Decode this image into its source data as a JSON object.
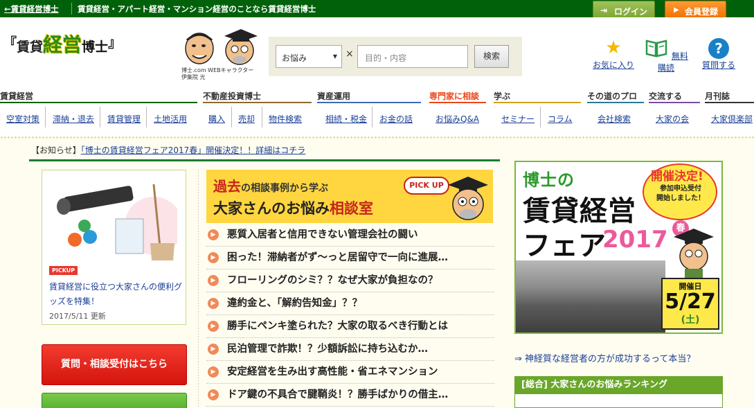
{
  "topbar": {
    "back_link": "←賃貸経営博士",
    "tagline": "賃貸経営・アパート経営・マンション経営のことなら賃貸経営博士",
    "login_label": "ログイン",
    "register_label": "会員登録"
  },
  "header": {
    "logo": {
      "open": "『",
      "part1": "賃貸",
      "part2": "経営",
      "part3": "博士",
      "close": "』"
    },
    "char_caption_1": "博士.com WEBキャラクター",
    "char_caption_2": "伊集院 光",
    "search": {
      "select_value": "お悩み",
      "times": "×",
      "keyword_placeholder": "目的・内容",
      "button_label": "検索"
    },
    "icons": [
      {
        "icon": "star-icon",
        "label": "お気に入り"
      },
      {
        "icon": "book-icon",
        "label": "無料購読"
      },
      {
        "icon": "question-icon",
        "label": "質問する"
      }
    ]
  },
  "nav": {
    "categories": [
      {
        "label": "賃貸経営",
        "color": "#00610a"
      },
      {
        "label": "不動産投資博士",
        "color": "#8b6a2e"
      },
      {
        "label": "資産運用",
        "color": "#3a6ab8"
      },
      {
        "label": "専門家に相談",
        "color": "#e9451c"
      },
      {
        "label": "学ぶ",
        "color": "#d4a018"
      },
      {
        "label": "その道のプロ",
        "color": "#2a7a8a"
      },
      {
        "label": "交流する",
        "color": "#7a4aa8"
      },
      {
        "label": "月刊誌",
        "color": "#333333"
      }
    ],
    "items": [
      "空室対策",
      "滞納・退去",
      "賃貸管理",
      "土地活用",
      "購入",
      "売却",
      "物件検索",
      "相続・税金",
      "お金の話",
      "お悩みQ&A",
      "セミナー",
      "コラム",
      "会社検索",
      "大家の会",
      "大家倶楽部"
    ]
  },
  "notice": {
    "prefix": "【お知らせ】",
    "link": "「博士の賃貸経営フェア2017春」開催決定！！詳細はコチラ"
  },
  "pickup_card": {
    "badge": "PICKUP",
    "title": "賃貸経営に役立つ大家さんの便利グッズを特集！",
    "date": "2017/5/11 更新"
  },
  "left_buttons": {
    "consult": "質問・相談受付はこちら"
  },
  "banner": {
    "line1_red": "過去",
    "line1_rest": "の相談事例から学ぶ",
    "line2_black": "大家さんのお悩み",
    "line2_red": "相談室",
    "pickup": "PICK UP"
  },
  "consult_list": [
    "悪質入居者と信用できない管理会社の闘い",
    "困った！滞納者がず～っと居留守で一向に進展…",
    "フローリングのシミ？？なぜ大家が負担なの？",
    "違約金と、「解約告知金」？？",
    "勝手にペンキ塗られた？大家の取るべき行動とは",
    "民泊管理で詐欺！？少額訴訟に持ち込むか…",
    "安定経営を生み出す高性能・省エネマンション",
    "ドア鍵の不具合で腱鞘炎！？勝手ばかりの借主…"
  ],
  "fair": {
    "line1": "博士の",
    "line2": "賃貸経営",
    "line3": "フェア",
    "year": "2017",
    "badge_title": "開催決定!",
    "badge_sub_1": "参加申込受付",
    "badge_sub_2": "開始しました！",
    "spring": "春",
    "date_label": "開催日",
    "date": "5/27",
    "weekday": "(土)"
  },
  "side_link": "⇒ 神経質な経営者の方が成功するって本当？",
  "ranking_title": "[総合] 大家さんのお悩みランキング"
}
